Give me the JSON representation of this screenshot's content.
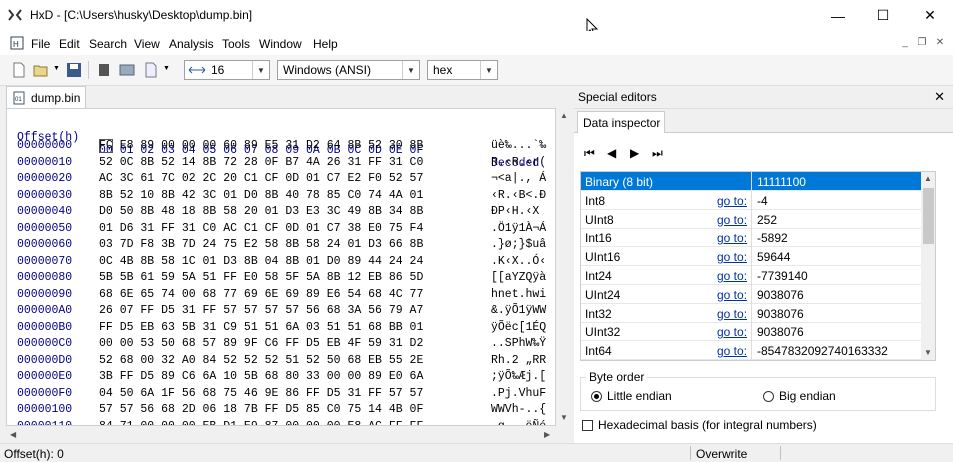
{
  "window": {
    "title": "HxD - [C:\\Users\\husky\\Desktop\\dump.bin]",
    "minimize": "—",
    "maximize": "☐",
    "close": "✕"
  },
  "menu": {
    "items": [
      "File",
      "Edit",
      "Search",
      "View",
      "Analysis",
      "Tools",
      "Window",
      "Help"
    ]
  },
  "toolbar": {
    "bytes_per_row": "16",
    "charset": "Windows (ANSI)",
    "offset_base": "hex"
  },
  "document": {
    "tab_label": "dump.bin"
  },
  "hex": {
    "header_offset": "Offset(h)",
    "header_columns": "00 01 02 03 04 05 06 07 08 09 0A 0B 0C 0D 0E 0F",
    "header_decoded": "Decoded",
    "rows": [
      {
        "offset": "00000000",
        "hex": "FC E8 89 00 00 00 60 89 E5 31 D2 64 8B 52 30 8B",
        "decoded": "üè‰...`‰"
      },
      {
        "offset": "00000010",
        "hex": "52 0C 8B 52 14 8B 72 28 0F B7 4A 26 31 FF 31 C0",
        "decoded": "R.‹R.‹r("
      },
      {
        "offset": "00000020",
        "hex": "AC 3C 61 7C 02 2C 20 C1 CF 0D 01 C7 E2 F0 52 57",
        "decoded": "¬<a|., Á"
      },
      {
        "offset": "00000030",
        "hex": "8B 52 10 8B 42 3C 01 D0 8B 40 78 85 C0 74 4A 01",
        "decoded": "‹R.‹B<.Ð"
      },
      {
        "offset": "00000040",
        "hex": "D0 50 8B 48 18 8B 58 20 01 D3 E3 3C 49 8B 34 8B",
        "decoded": "ÐP‹H.‹X "
      },
      {
        "offset": "00000050",
        "hex": "01 D6 31 FF 31 C0 AC C1 CF 0D 01 C7 38 E0 75 F4",
        "decoded": ".Ö1ÿ1À¬Á"
      },
      {
        "offset": "00000060",
        "hex": "03 7D F8 3B 7D 24 75 E2 58 8B 58 24 01 D3 66 8B",
        "decoded": ".}ø;}$uâ"
      },
      {
        "offset": "00000070",
        "hex": "0C 4B 8B 58 1C 01 D3 8B 04 8B 01 D0 89 44 24 24",
        "decoded": ".K‹X..Ó‹"
      },
      {
        "offset": "00000080",
        "hex": "5B 5B 61 59 5A 51 FF E0 58 5F 5A 8B 12 EB 86 5D",
        "decoded": "[[aYZQÿà"
      },
      {
        "offset": "00000090",
        "hex": "68 6E 65 74 00 68 77 69 6E 69 89 E6 54 68 4C 77",
        "decoded": "hnet.hwi"
      },
      {
        "offset": "000000A0",
        "hex": "26 07 FF D5 31 FF 57 57 57 57 56 68 3A 56 79 A7",
        "decoded": "&.ÿÕ1ÿWW"
      },
      {
        "offset": "000000B0",
        "hex": "FF D5 EB 63 5B 31 C9 51 51 6A 03 51 51 68 BB 01",
        "decoded": "ÿÕëc[1ÉQ"
      },
      {
        "offset": "000000C0",
        "hex": "00 00 53 50 68 57 89 9F C6 FF D5 EB 4F 59 31 D2",
        "decoded": "..SPhW‰Ÿ"
      },
      {
        "offset": "000000D0",
        "hex": "52 68 00 32 A0 84 52 52 52 51 52 50 68 EB 55 2E",
        "decoded": "Rh.2 „RR"
      },
      {
        "offset": "000000E0",
        "hex": "3B FF D5 89 C6 6A 10 5B 68 80 33 00 00 89 E0 6A",
        "decoded": ";ÿÕ‰Æj.["
      },
      {
        "offset": "000000F0",
        "hex": "04 50 6A 1F 56 68 75 46 9E 86 FF D5 31 FF 57 57",
        "decoded": ".Pj.VhuF"
      },
      {
        "offset": "00000100",
        "hex": "57 57 56 68 2D 06 18 7B FF D5 85 C0 75 14 4B 0F",
        "decoded": "WWVh-..{"
      },
      {
        "offset": "00000110",
        "hex": "84 71 00 00 00 EB D1 E9 87 00 00 00 E8 AC FF FF",
        "decoded": "„q...ëÑé"
      }
    ]
  },
  "special_editors": {
    "title": "Special editors",
    "close": "✕",
    "tab_label": "Data inspector",
    "nav": [
      "⏮",
      "◀",
      "▶",
      "⏭"
    ],
    "rows": [
      {
        "name": "Binary (8 bit)",
        "goto": "",
        "value": "11111100"
      },
      {
        "name": "Int8",
        "goto": "go to:",
        "value": "-4"
      },
      {
        "name": "UInt8",
        "goto": "go to:",
        "value": "252"
      },
      {
        "name": "Int16",
        "goto": "go to:",
        "value": "-5892"
      },
      {
        "name": "UInt16",
        "goto": "go to:",
        "value": "59644"
      },
      {
        "name": "Int24",
        "goto": "go to:",
        "value": "-7739140"
      },
      {
        "name": "UInt24",
        "goto": "go to:",
        "value": "9038076"
      },
      {
        "name": "Int32",
        "goto": "go to:",
        "value": "9038076"
      },
      {
        "name": "UInt32",
        "goto": "go to:",
        "value": "9038076"
      },
      {
        "name": "Int64",
        "goto": "go to:",
        "value": "-8547832092740163332"
      }
    ],
    "byte_order_label": "Byte order",
    "little_endian": "Little endian",
    "big_endian": "Big endian",
    "hex_basis_label": "Hexadecimal basis (for integral numbers)"
  },
  "status": {
    "offset": "Offset(h): 0",
    "mode": "Overwrite"
  },
  "colors": {
    "selection": "#0078d7",
    "offset_text": "#00008b",
    "link": "#003399"
  }
}
